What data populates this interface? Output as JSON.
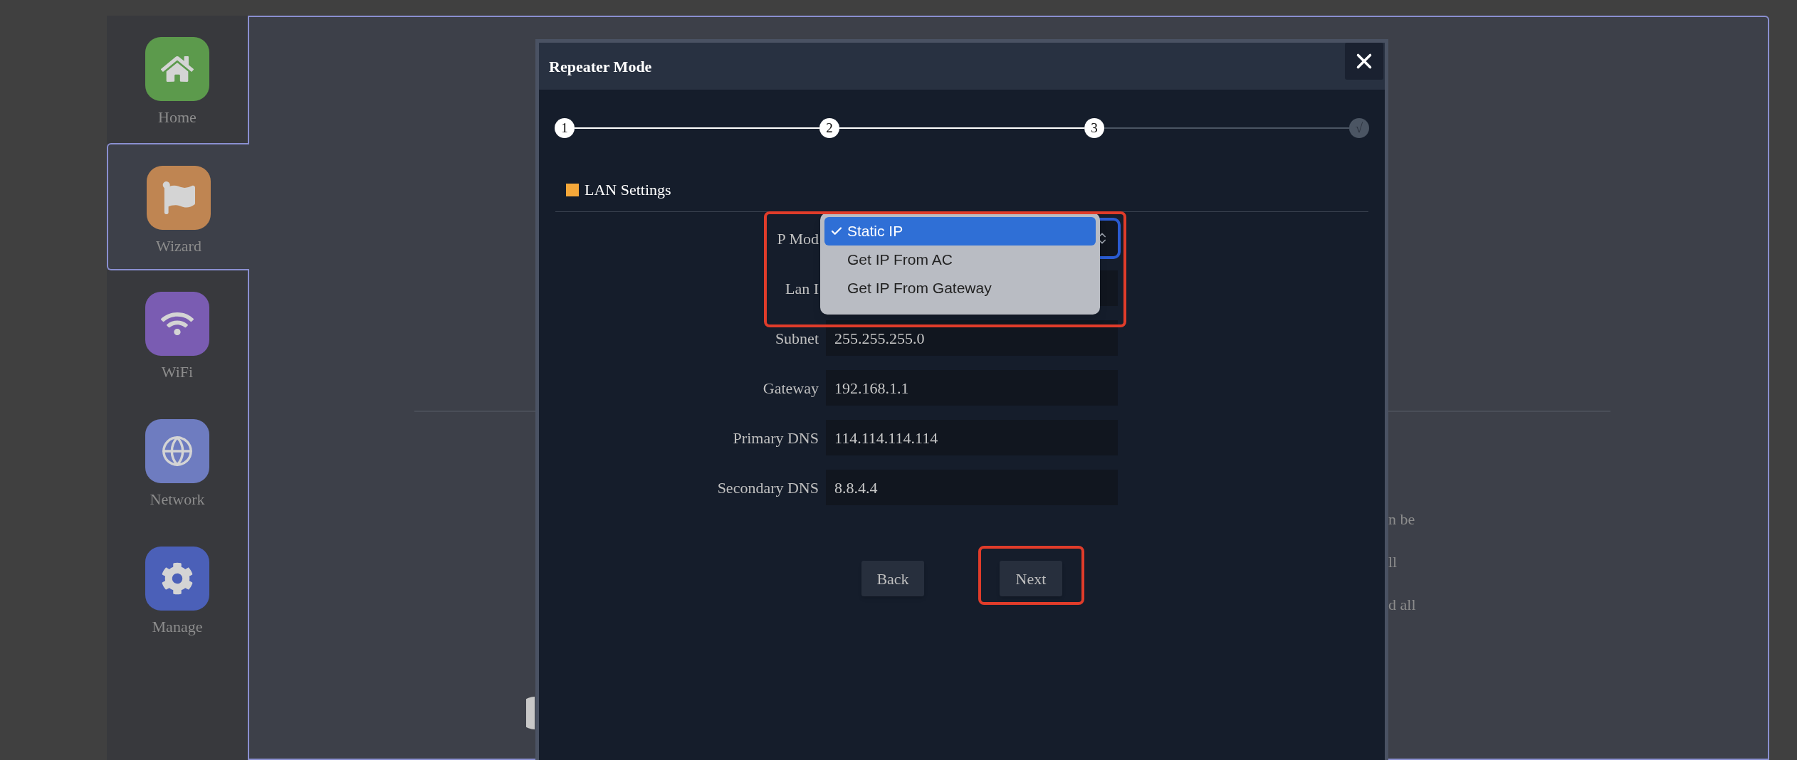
{
  "sidebar": {
    "items": [
      {
        "label": "Home",
        "kind": "home",
        "color": "#5c9a4c",
        "selected": false
      },
      {
        "label": "Wizard",
        "kind": "flag",
        "color": "#bf8552",
        "selected": true
      },
      {
        "label": "WiFi",
        "kind": "wifi",
        "color": "#7a5cb2",
        "selected": false
      },
      {
        "label": "Network",
        "kind": "globe",
        "color": "#6e7cc0",
        "selected": false
      },
      {
        "label": "Manage",
        "kind": "gear",
        "color": "#4b60b8",
        "selected": false
      }
    ]
  },
  "page": {
    "lines": [
      "n be",
      "ll",
      "d all"
    ]
  },
  "dialog": {
    "title": "Repeater Mode",
    "steps": [
      {
        "label": "1",
        "reached": true
      },
      {
        "label": "2",
        "reached": true
      },
      {
        "label": "3",
        "reached": true
      },
      {
        "label": "√",
        "reached": false
      }
    ],
    "section": {
      "title": "LAN Settings"
    },
    "fields": [
      {
        "label": "P Mod",
        "kind": "select",
        "focused": true
      },
      {
        "label": "Lan I",
        "kind": "input"
      },
      {
        "label": "Subnet",
        "kind": "input",
        "value": "255.255.255.0"
      },
      {
        "label": "Gateway",
        "kind": "input",
        "value": "192.168.1.1"
      },
      {
        "label": "Primary DNS",
        "kind": "input",
        "value": "114.114.114.114"
      },
      {
        "label": "Secondary DNS",
        "kind": "input",
        "value": "8.8.4.4"
      }
    ],
    "dropdown": {
      "annotated": true,
      "options": [
        {
          "label": "Static IP",
          "selected": true
        },
        {
          "label": "Get IP From AC",
          "selected": false
        },
        {
          "label": "Get IP From Gateway",
          "selected": false
        }
      ]
    },
    "buttons": [
      {
        "label": "Back",
        "annotated": false
      },
      {
        "label": "Next",
        "annotated": true
      }
    ]
  }
}
